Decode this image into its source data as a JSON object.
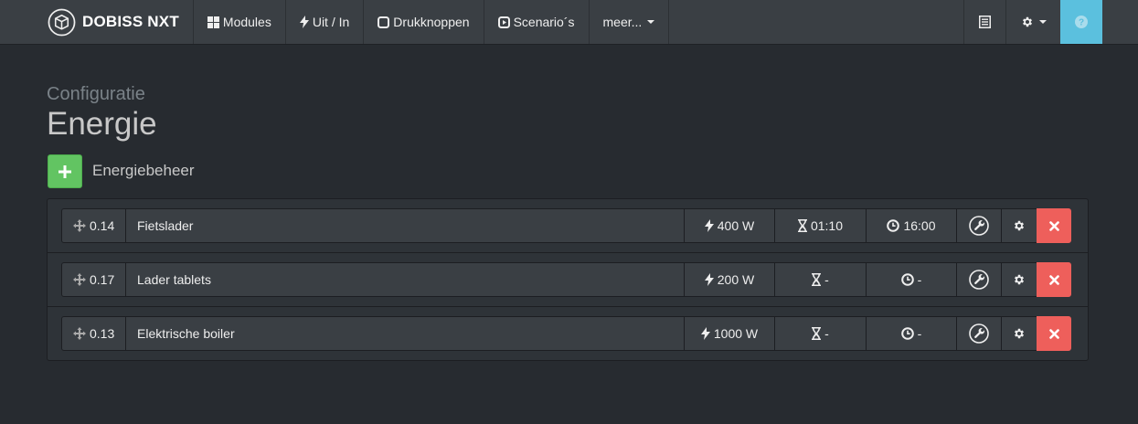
{
  "navbar": {
    "brand": "DOBISS NXT",
    "items": [
      {
        "label": "Modules",
        "icon": "grid-icon"
      },
      {
        "label": "Uit / In",
        "icon": "bolt-icon"
      },
      {
        "label": "Drukknoppen",
        "icon": "square-icon"
      },
      {
        "label": "Scenario´s",
        "icon": "play-square-icon"
      },
      {
        "label": "meer...",
        "icon": "caret-down-icon"
      }
    ],
    "right": [
      {
        "icon": "list-alt-icon"
      },
      {
        "icon": "cog-icon"
      },
      {
        "icon": "question-icon"
      }
    ]
  },
  "header": {
    "subtitle": "Configuratie",
    "title": "Energie"
  },
  "add": {
    "label": "Energiebeheer"
  },
  "rows": [
    {
      "id": "0.14",
      "name": "Fietslader",
      "power": "400 W",
      "duration": "01:10",
      "time": "16:00"
    },
    {
      "id": "0.17",
      "name": "Lader tablets",
      "power": "200 W",
      "duration": "-",
      "time": "-"
    },
    {
      "id": "0.13",
      "name": "Elektrische boiler",
      "power": "1000 W",
      "duration": "-",
      "time": "-"
    }
  ],
  "colors": {
    "background": "#272b30",
    "navbar": "#3a3f44",
    "success": "#62c462",
    "danger": "#ee5f5b",
    "info": "#5bc0de"
  }
}
